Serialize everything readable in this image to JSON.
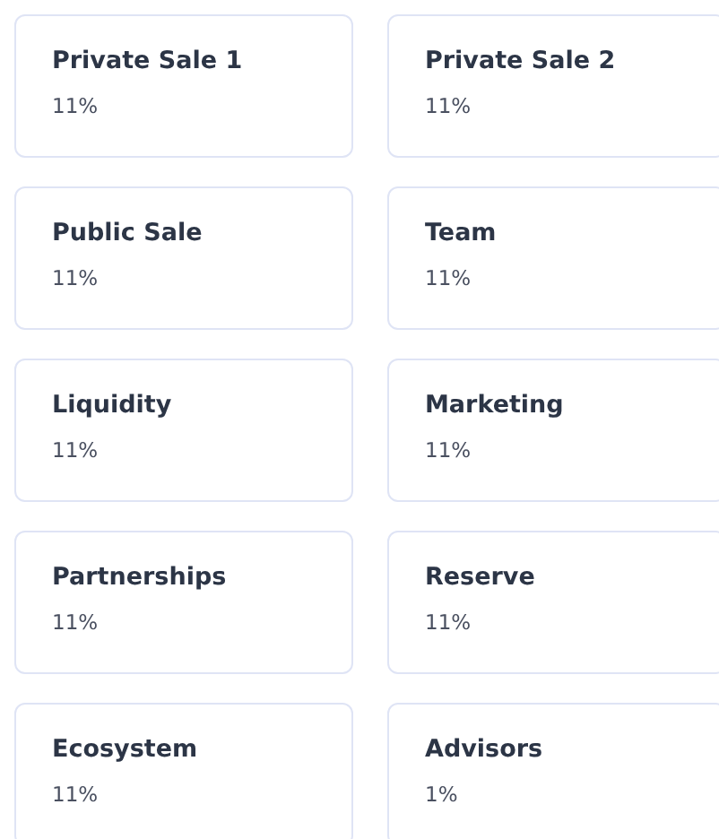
{
  "allocations": [
    {
      "name": "Private Sale 1",
      "percent": "11%"
    },
    {
      "name": "Private Sale 2",
      "percent": "11%"
    },
    {
      "name": "Public Sale",
      "percent": "11%"
    },
    {
      "name": "Team",
      "percent": "11%"
    },
    {
      "name": "Liquidity",
      "percent": "11%"
    },
    {
      "name": "Marketing",
      "percent": "11%"
    },
    {
      "name": "Partnerships",
      "percent": "11%"
    },
    {
      "name": "Reserve",
      "percent": "11%"
    },
    {
      "name": "Ecosystem",
      "percent": "11%"
    },
    {
      "name": "Advisors",
      "percent": "1%"
    }
  ]
}
